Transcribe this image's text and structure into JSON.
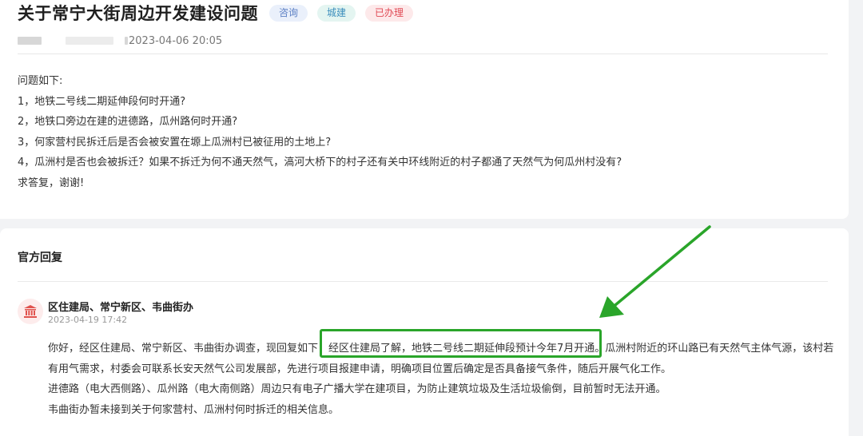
{
  "header": {
    "title": "关于常宁大街周边开发建设问题",
    "tags": [
      "咨询",
      "城建",
      "已办理"
    ],
    "datetime": "2023-04-06 20:05"
  },
  "question": {
    "lines": [
      "问题如下:",
      "1，地铁二号线二期延伸段何时开通?",
      "2，地铁口旁边在建的进德路，瓜州路何时开通?",
      "3，何家营村民拆迁后是否会被安置在塬上瓜洲村已被征用的土地上?",
      "4，瓜洲村是否也会被拆迁？如果不拆迁为何不通天然气，滈河大桥下的村子还有关中环线附近的村子都通了天然气为何瓜州村没有?",
      "求答复，谢谢!"
    ]
  },
  "official": {
    "section_title": "官方回复",
    "org_name": "区住建局、常宁新区、韦曲街办",
    "date": "2023-04-19 17:42",
    "lines": [
      "你好，经区住建局、常宁新区、韦曲街办调查，现回复如下：经区住建局了解，地铁二号线二期延伸段预计今年7月开通。瓜洲村附近的环山路已有天然气主体气源，该村若",
      "有用气需求，村委会可联系长安天然气公司发展部，先进行项目报建申请，明确项目位置后确定是否具备接气条件，随后开展气化工作。",
      "进德路（电大西侧路）、瓜州路（电大南侧路）周边只有电子广播大学在建项目，为防止建筑垃圾及生活垃圾偷倒，目前暂时无法开通。",
      "韦曲街办暂未接到关于何家营村、瓜洲村何时拆迁的相关信息。"
    ]
  },
  "colors": {
    "annotation_green": "#2aa52a",
    "tag_red_text": "#e04a55",
    "tag_blue_text": "#5b7fc4"
  },
  "icons": [
    "government-building-icon"
  ]
}
